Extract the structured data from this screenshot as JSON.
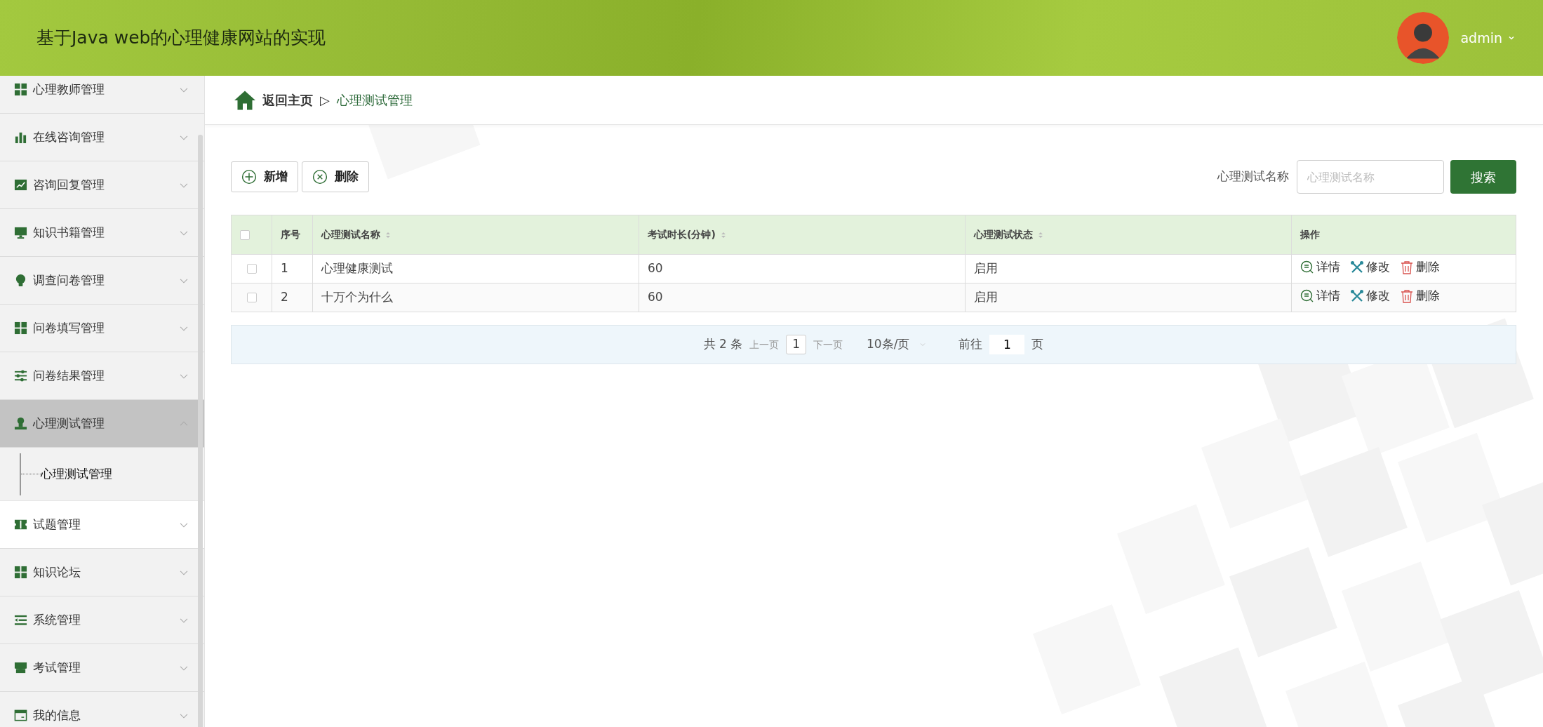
{
  "header": {
    "title": "基于Java web的心理健康网站的实现",
    "user": "admin"
  },
  "sidebar": {
    "items": [
      {
        "label": "心理教师管理",
        "expanded": false,
        "selected": false,
        "hovered": false
      },
      {
        "label": "在线咨询管理",
        "expanded": false,
        "selected": false,
        "hovered": false
      },
      {
        "label": "咨询回复管理",
        "expanded": false,
        "selected": false,
        "hovered": false
      },
      {
        "label": "知识书籍管理",
        "expanded": false,
        "selected": false,
        "hovered": false
      },
      {
        "label": "调查问卷管理",
        "expanded": false,
        "selected": false,
        "hovered": false
      },
      {
        "label": "问卷填写管理",
        "expanded": false,
        "selected": false,
        "hovered": false
      },
      {
        "label": "问卷结果管理",
        "expanded": false,
        "selected": false,
        "hovered": false
      },
      {
        "label": "心理测试管理",
        "expanded": true,
        "selected": true,
        "hovered": false,
        "children": [
          {
            "label": "心理测试管理"
          }
        ]
      },
      {
        "label": "试题管理",
        "expanded": false,
        "selected": false,
        "hovered": true
      },
      {
        "label": "知识论坛",
        "expanded": false,
        "selected": false,
        "hovered": false
      },
      {
        "label": "系统管理",
        "expanded": false,
        "selected": false,
        "hovered": false
      },
      {
        "label": "考试管理",
        "expanded": false,
        "selected": false,
        "hovered": false
      },
      {
        "label": "我的信息",
        "expanded": false,
        "selected": false,
        "hovered": false
      }
    ]
  },
  "breadcrumb": {
    "home": "返回主页",
    "separator": "▷",
    "current": "心理测试管理"
  },
  "toolbar": {
    "buttons": [
      {
        "kind": "add",
        "label": "新增"
      },
      {
        "kind": "delete",
        "label": "删除"
      }
    ],
    "search_label": "心理测试名称",
    "search": {
      "placeholder": "心理测试名称"
    },
    "search_button": "搜索"
  },
  "table": {
    "all_checked": false,
    "columns": [
      {
        "label": "序号",
        "sortable": false
      },
      {
        "label": "心理测试名称",
        "sortable": true
      },
      {
        "label": "考试时长(分钟)",
        "sortable": true
      },
      {
        "label": "心理测试状态",
        "sortable": true
      },
      {
        "label": "操作",
        "sortable": false
      }
    ],
    "rows": [
      {
        "checked": false,
        "cells": [
          "1",
          "心理健康测试",
          "60",
          "启用"
        ],
        "actions": [
          {
            "kind": "detail",
            "label": "详情"
          },
          {
            "kind": "edit",
            "label": "修改"
          },
          {
            "kind": "delete",
            "label": "删除"
          }
        ]
      },
      {
        "checked": false,
        "cells": [
          "2",
          "十万个为什么",
          "60",
          "启用"
        ],
        "actions": [
          {
            "kind": "detail",
            "label": "详情"
          },
          {
            "kind": "edit",
            "label": "修改"
          },
          {
            "kind": "delete",
            "label": "删除"
          }
        ]
      }
    ]
  },
  "pagination": {
    "total": "共 2 条",
    "prev": "上一页",
    "page": "1",
    "next": "下一页",
    "page_size": "10条/页",
    "goto_label": "前往",
    "goto_value": "1",
    "goto_suffix": "页"
  }
}
